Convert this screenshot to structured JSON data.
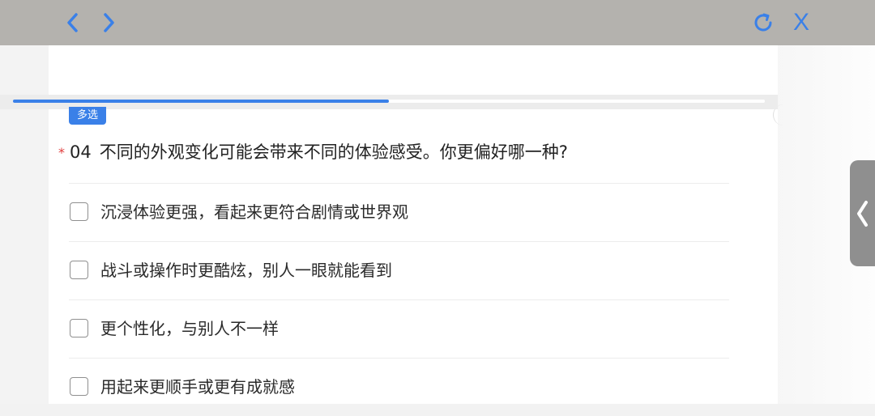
{
  "toolbar": {
    "back_icon": "chevron-left-icon",
    "forward_icon": "chevron-right-icon",
    "refresh_icon": "refresh-icon",
    "close_label": "X"
  },
  "colors": {
    "accent": "#3a80e8",
    "toolbar_bg": "#b4b2ae",
    "required": "#e03b3b",
    "side_tab": "#8f8f8f"
  },
  "progress": {
    "fraction": 0.5
  },
  "question": {
    "badge": "多选",
    "required_mark": "*",
    "number": "04",
    "text": "不同的外观变化可能会带来不同的体验感受。你更偏好哪一种?",
    "options": [
      {
        "label": "沉浸体验更强，看起来更符合剧情或世界观",
        "checked": false
      },
      {
        "label": "战斗或操作时更酷炫，别人一眼就能看到",
        "checked": false
      },
      {
        "label": "更个性化，与别人不一样",
        "checked": false
      },
      {
        "label": "用起来更顺手或更有成就感",
        "checked": false
      }
    ]
  },
  "side_tab": {
    "icon": "chevron-left-icon"
  }
}
